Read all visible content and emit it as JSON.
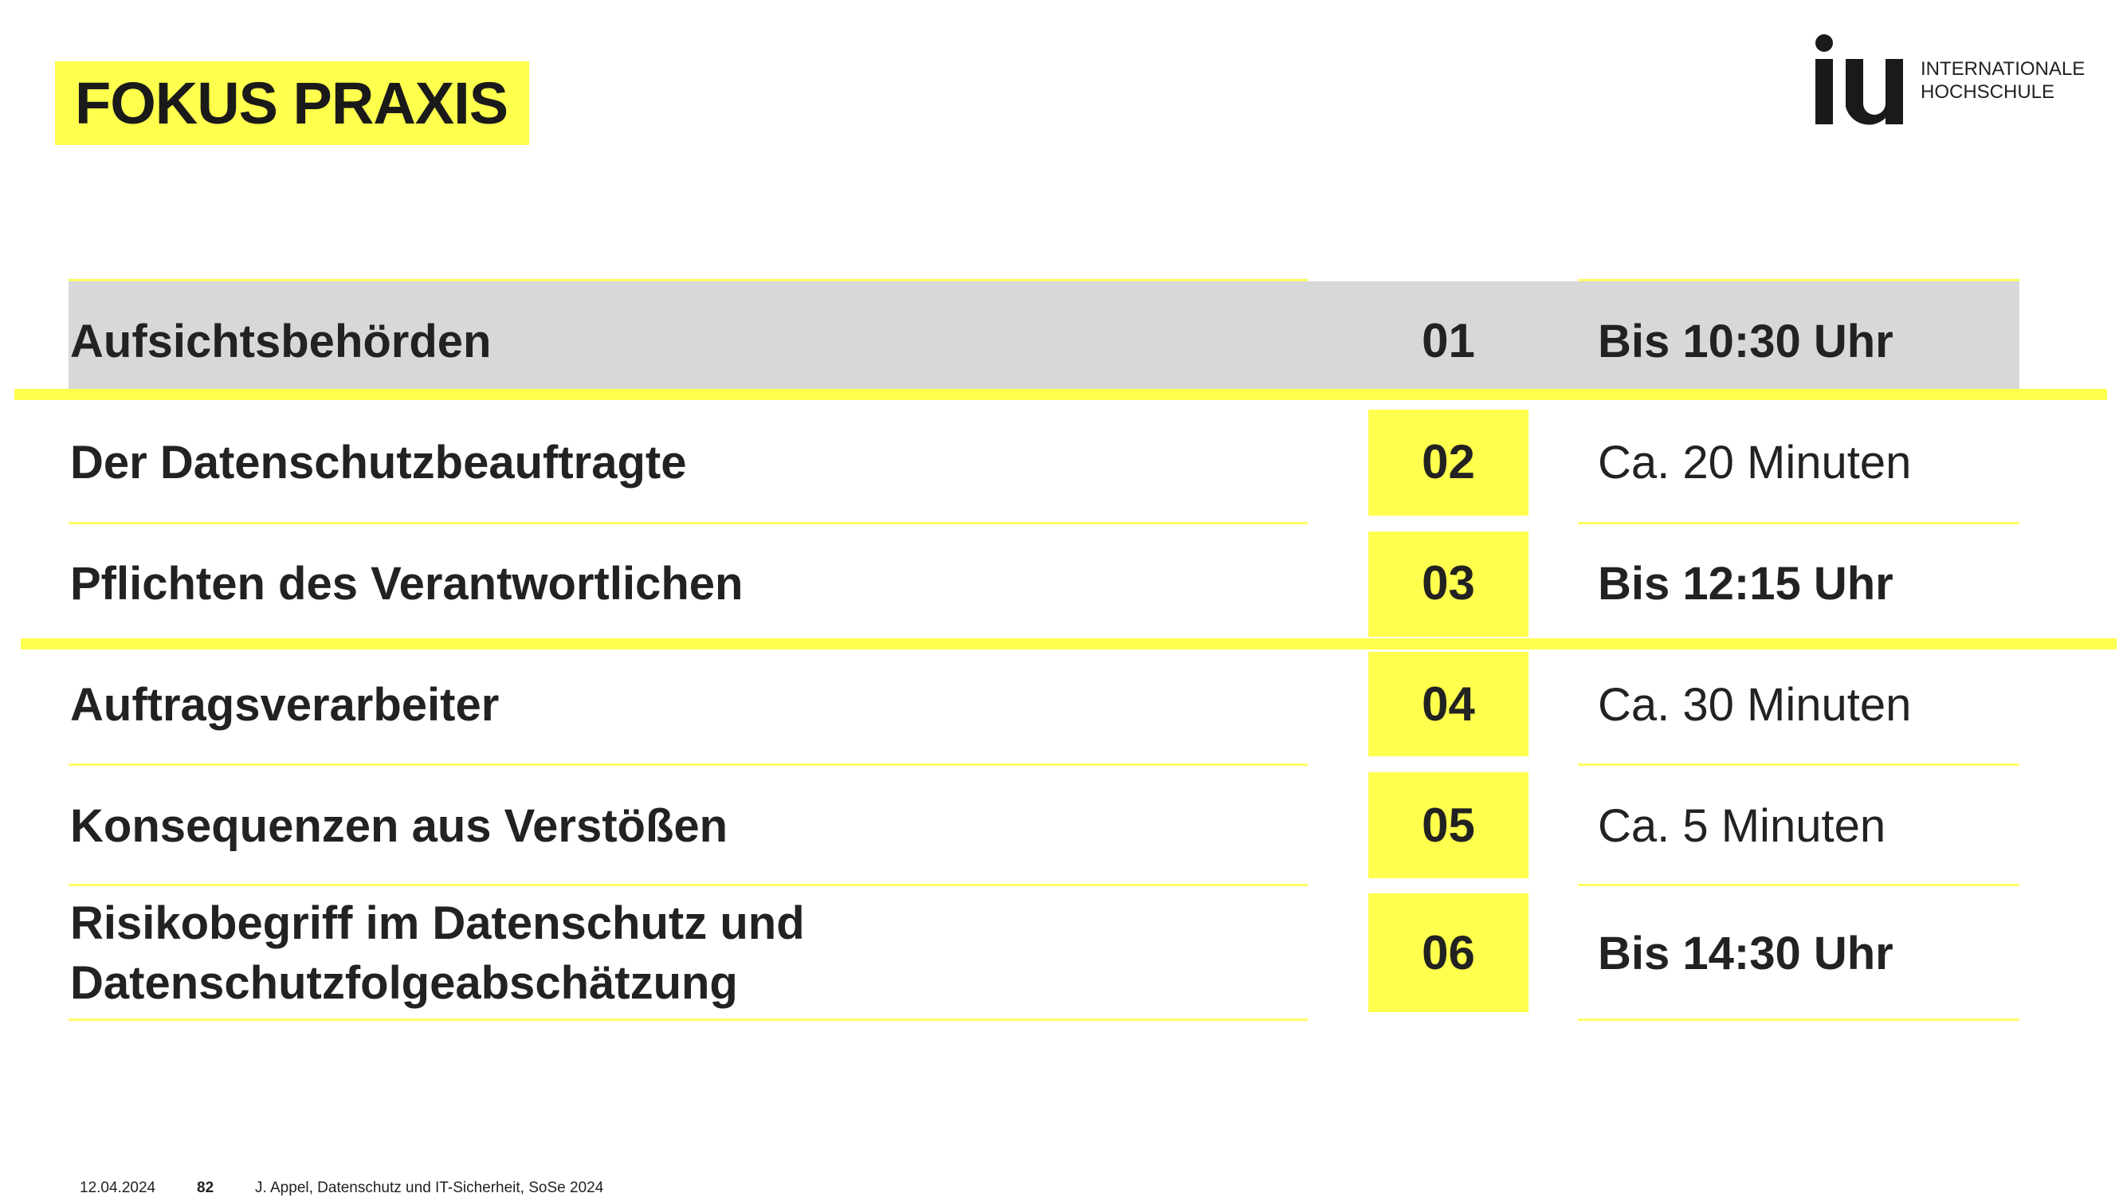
{
  "header": {
    "title": "FOKUS PRAXIS"
  },
  "logo": {
    "mark": "iu",
    "line1": "INTERNATIONALE",
    "line2": "HOCHSCHULE"
  },
  "agenda": [
    {
      "topic": "Aufsichtsbehörden",
      "number": "01",
      "time": "Bis 10:30 Uhr",
      "highlighted": true
    },
    {
      "topic": "Der Datenschutzbeauftragte",
      "number": "02",
      "time": "Ca. 20 Minuten",
      "highlighted": false
    },
    {
      "topic": "Pflichten des Verantwortlichen",
      "number": "03",
      "time": "Bis 12:15 Uhr",
      "highlighted": false
    },
    {
      "topic": "Auftragsverarbeiter",
      "number": "04",
      "time": "Ca. 30 Minuten",
      "highlighted": false
    },
    {
      "topic": "Konsequenzen aus Verstößen",
      "number": "05",
      "time": "Ca. 5 Minuten",
      "highlighted": false
    },
    {
      "topic": "Risikobegriff im Datenschutz und\nDatenschutzfolgeabschätzung",
      "number": "06",
      "time": "Bis 14:30 Uhr",
      "highlighted": false
    }
  ],
  "footer": {
    "date": "12.04.2024",
    "page": "82",
    "text": "J. Appel, Datenschutz und IT-Sicherheit, SoSe 2024"
  },
  "colors": {
    "accent": "#ffff4d",
    "highlight_row": "#d8d8d8",
    "text": "#222222"
  }
}
